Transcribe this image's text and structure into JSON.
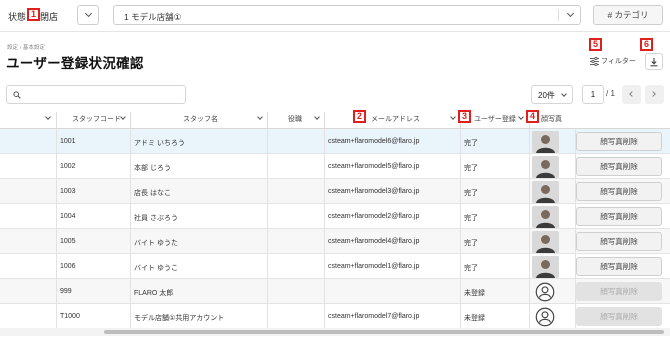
{
  "topbar": {
    "state_label": "状態",
    "state_value": "閉店",
    "store_select": "1 モデル店舗①",
    "category_button": "# カテゴリ"
  },
  "breadcrumb": "設定 › 基本設定",
  "page_title": "ユーザー登録状況確認",
  "toolbar": {
    "filter_label": "フィルター"
  },
  "search": {
    "placeholder": ""
  },
  "pagination": {
    "page_size": "20件",
    "current_page": "1",
    "total_pages": "/ 1"
  },
  "markers": [
    "1",
    "2",
    "3",
    "4",
    "5",
    "6"
  ],
  "columns": {
    "staff_code": "スタッフコード",
    "staff_name": "スタッフ名",
    "role": "役職",
    "email": "メールアドレス",
    "user_registration": "ユーザー登録",
    "photo": "顔写真"
  },
  "rows": [
    {
      "code": "1001",
      "name": "アドミ いちろう",
      "role": "",
      "email": "csteam+flaromodel6@flaro.jp",
      "status": "完了",
      "has_photo": true,
      "action": "顔写真削除",
      "action_enabled": true,
      "selected": true
    },
    {
      "code": "1002",
      "name": "本部 じろう",
      "role": "",
      "email": "csteam+flaromodel5@flaro.jp",
      "status": "完了",
      "has_photo": true,
      "action": "顔写真削除",
      "action_enabled": true
    },
    {
      "code": "1003",
      "name": "店長 はなこ",
      "role": "",
      "email": "csteam+flaromodel3@flaro.jp",
      "status": "完了",
      "has_photo": true,
      "action": "顔写真削除",
      "action_enabled": true
    },
    {
      "code": "1004",
      "name": "社員 さぶろう",
      "role": "",
      "email": "csteam+flaromodel2@flaro.jp",
      "status": "完了",
      "has_photo": true,
      "action": "顔写真削除",
      "action_enabled": true
    },
    {
      "code": "1005",
      "name": "バイト ゆうた",
      "role": "",
      "email": "csteam+flaromodel4@flaro.jp",
      "status": "完了",
      "has_photo": true,
      "action": "顔写真削除",
      "action_enabled": true
    },
    {
      "code": "1006",
      "name": "バイト ゆうこ",
      "role": "",
      "email": "csteam+flaromodel1@flaro.jp",
      "status": "完了",
      "has_photo": true,
      "action": "顔写真削除",
      "action_enabled": true
    },
    {
      "code": "999",
      "name": "FLARO 太郎",
      "role": "",
      "email": "",
      "status": "未登録",
      "has_photo": false,
      "action": "顔写真削除",
      "action_enabled": false
    },
    {
      "code": "T1000",
      "name": "モデル店舗①共用アカウント",
      "role": "",
      "email": "csteam+flaromodel7@flaro.jp",
      "status": "未登録",
      "has_photo": false,
      "action": "顔写真削除",
      "action_enabled": false
    }
  ],
  "colors": {
    "marker": "#e0201c",
    "selected_row": "#eaf4fb"
  }
}
